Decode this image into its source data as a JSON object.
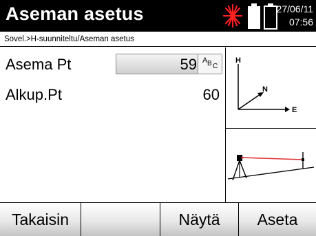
{
  "app": {
    "title": "Aseman asetus",
    "date": "27/06/11",
    "time": "07:56",
    "laser_icon": "laser-pointer-icon",
    "battery_icon": "battery-icon"
  },
  "breadcrumb": "Sovel.>H-suunniteltu/Aseman asetus",
  "form": {
    "station_label": "Asema Pt",
    "station_value": "59",
    "input_mode": {
      "a": "A",
      "b": "B",
      "c": "C"
    },
    "backsight_label": "Alkup.Pt",
    "backsight_value": "60"
  },
  "diagram": {
    "axis_h": "H",
    "axis_n": "N",
    "axis_e": "E"
  },
  "softkeys": [
    {
      "label": "Takaisin"
    },
    {
      "label": ""
    },
    {
      "label": "Näytä"
    },
    {
      "label": "Aseta"
    }
  ],
  "colors": {
    "titlebar": "#000000",
    "laser": "#ff0000",
    "diagram_line": "#e03030"
  }
}
